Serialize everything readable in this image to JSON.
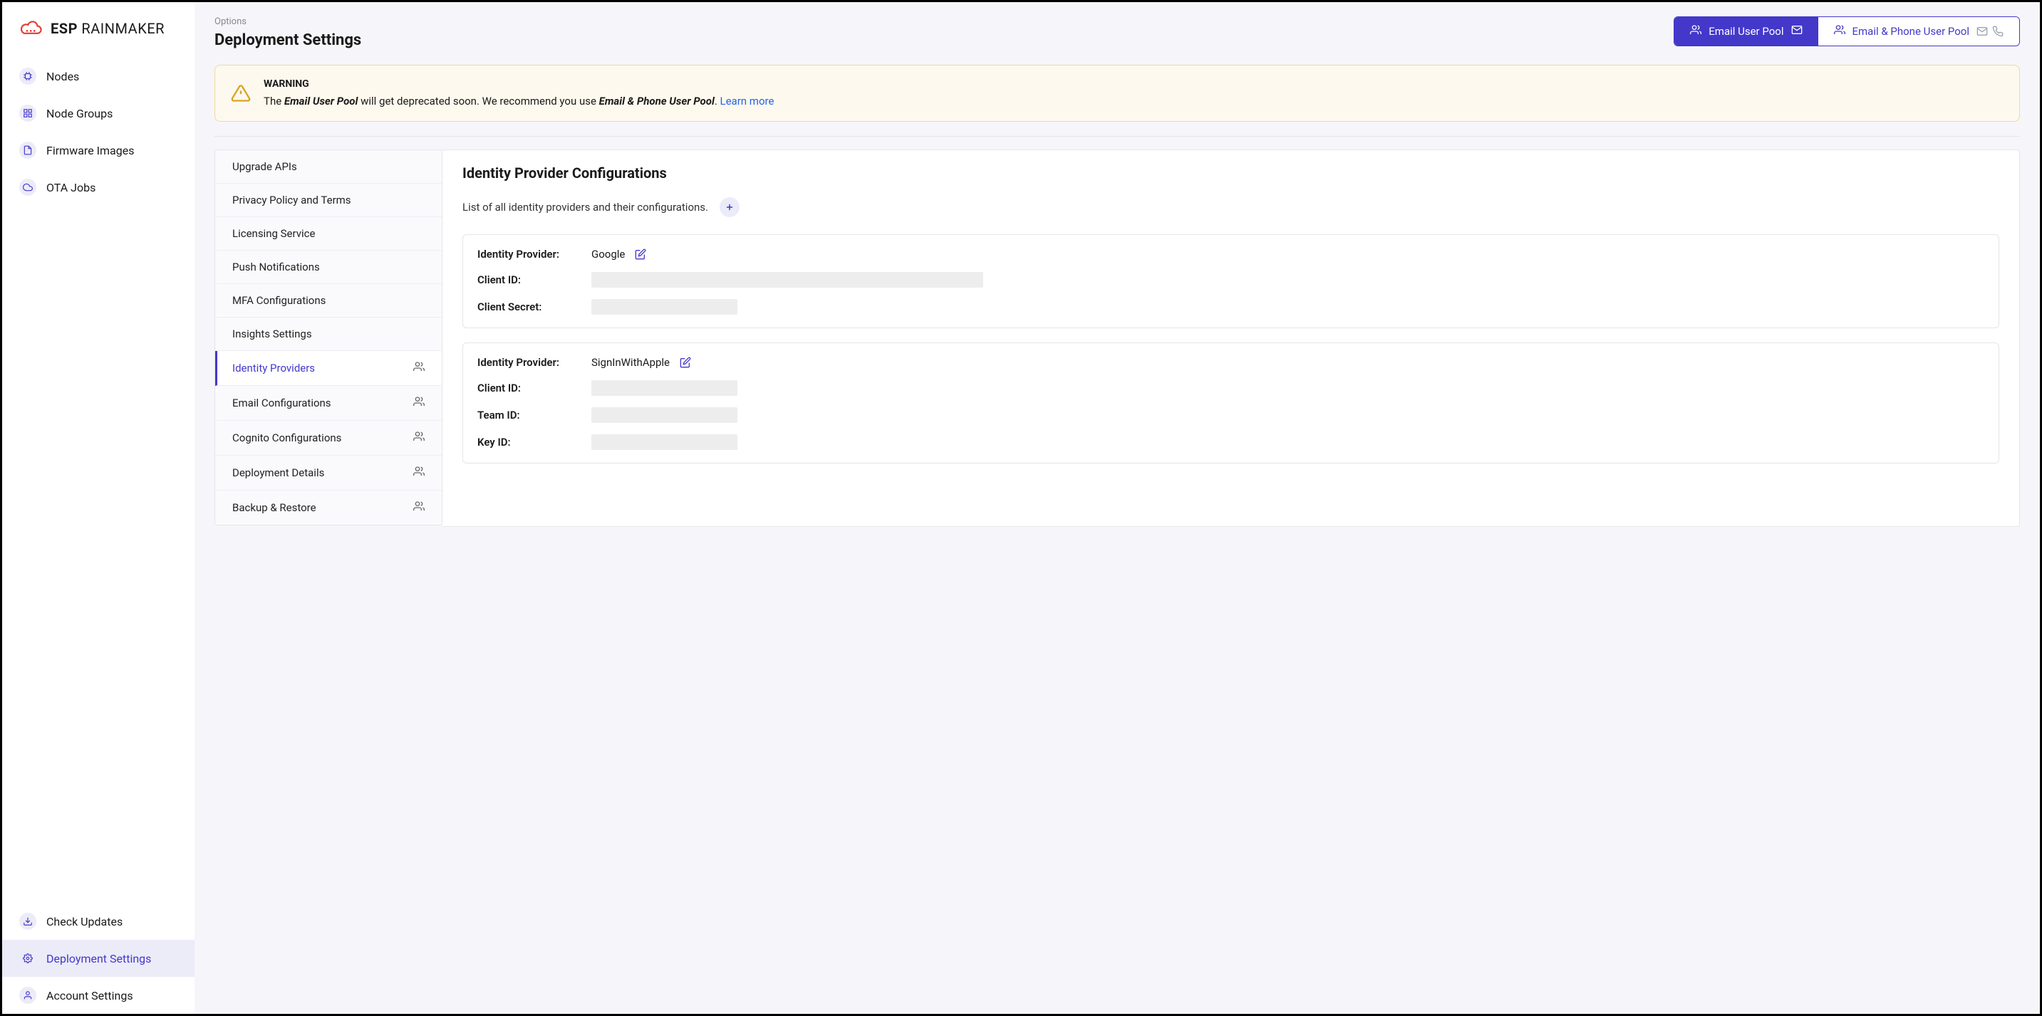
{
  "brand": {
    "name_bold": "ESP",
    "name_light": " RAINMAKER"
  },
  "nav": {
    "items": [
      {
        "key": "nodes",
        "label": "Nodes"
      },
      {
        "key": "node-groups",
        "label": "Node Groups"
      },
      {
        "key": "firmware-images",
        "label": "Firmware Images"
      },
      {
        "key": "ota-jobs",
        "label": "OTA Jobs"
      }
    ],
    "bottom": [
      {
        "key": "check-updates",
        "label": "Check Updates"
      },
      {
        "key": "deployment-settings",
        "label": "Deployment Settings",
        "active": true
      },
      {
        "key": "account-settings",
        "label": "Account Settings"
      }
    ]
  },
  "header": {
    "breadcrumb": "Options",
    "title": "Deployment Settings"
  },
  "poolTabs": {
    "email": "Email User Pool",
    "emailPhone": "Email & Phone User Pool"
  },
  "warning": {
    "title": "WARNING",
    "prefix": "The ",
    "strong1": "Email User Pool",
    "mid": " will get deprecated soon. We recommend you use ",
    "strong2": "Email & Phone User Pool",
    "suffix": ". ",
    "link": "Learn more"
  },
  "settingsTabs": [
    {
      "label": "Upgrade APIs",
      "suffix": false
    },
    {
      "label": "Privacy Policy and Terms",
      "suffix": false
    },
    {
      "label": "Licensing Service",
      "suffix": false
    },
    {
      "label": "Push Notifications",
      "suffix": false
    },
    {
      "label": "MFA Configurations",
      "suffix": false
    },
    {
      "label": "Insights Settings",
      "suffix": false
    },
    {
      "label": "Identity Providers",
      "suffix": true,
      "active": true
    },
    {
      "label": "Email Configurations",
      "suffix": true
    },
    {
      "label": "Cognito Configurations",
      "suffix": true
    },
    {
      "label": "Deployment Details",
      "suffix": true
    },
    {
      "label": "Backup & Restore",
      "suffix": true
    }
  ],
  "panel": {
    "title": "Identity Provider Configurations",
    "subtitle": "List of all identity providers and their configurations.",
    "providers": [
      {
        "name": "Google",
        "rows": [
          {
            "label": "Identity Provider:",
            "value": "Google",
            "edit": true
          },
          {
            "label": "Client ID:",
            "redact": "w1"
          },
          {
            "label": "Client Secret:",
            "redact": "w2"
          }
        ]
      },
      {
        "name": "SignInWithApple",
        "rows": [
          {
            "label": "Identity Provider:",
            "value": "SignInWithApple",
            "edit": true
          },
          {
            "label": "Client ID:",
            "redact": "w2"
          },
          {
            "label": "Team ID:",
            "redact": "w2"
          },
          {
            "label": "Key ID:",
            "redact": "w2"
          }
        ]
      }
    ]
  }
}
